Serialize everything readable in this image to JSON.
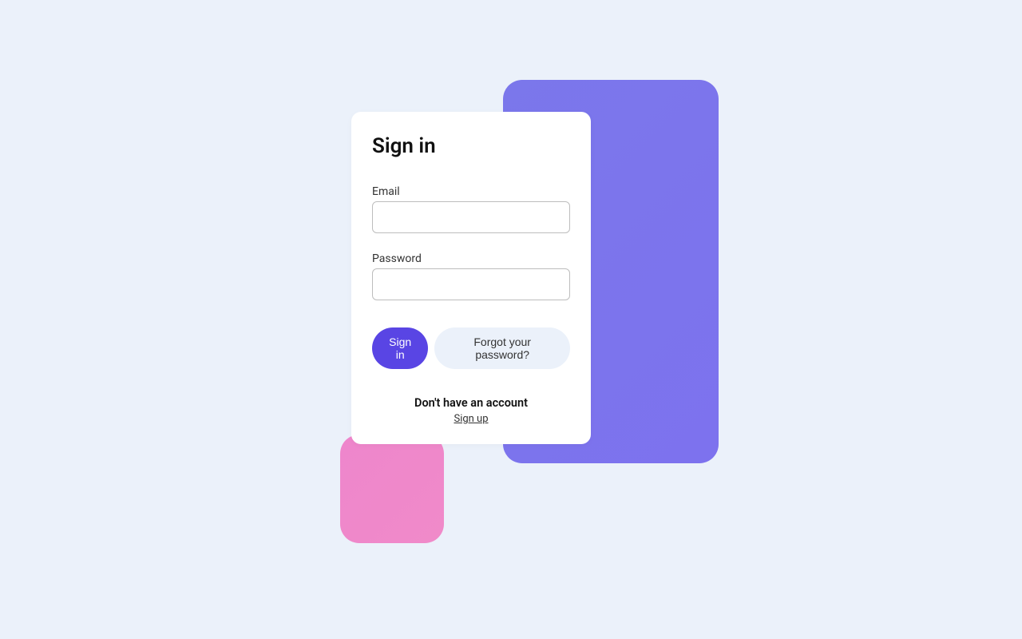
{
  "form": {
    "title": "Sign in",
    "email": {
      "label": "Email",
      "value": ""
    },
    "password": {
      "label": "Password",
      "value": ""
    },
    "submit_label": "Sign in",
    "forgot_label": "Forgot your password?"
  },
  "footer": {
    "prompt": "Don't have an account",
    "signup_label": "Sign up"
  },
  "colors": {
    "background": "#ebf1fa",
    "primary": "#5945e4",
    "accent_purple": "#7b77eb",
    "accent_pink": "#ee86cc"
  }
}
